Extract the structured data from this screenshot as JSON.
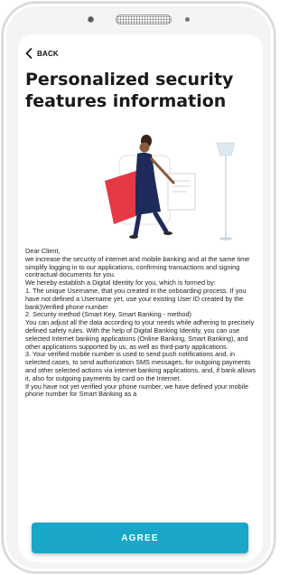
{
  "nav": {
    "back_label": "BACK"
  },
  "header": {
    "title": "Personalized security features information"
  },
  "hero": {
    "illustration": "woman-with-phone-and-document-illustration",
    "accent": "#e63946",
    "lamp_color": "#dde8f0"
  },
  "body": {
    "paragraphs": [
      "Dear Client,",
      "we increase the security of internet and mobile banking and at the same time simplify logging in to our applications, confirming transactions and signing contractual documents for you.",
      "We hereby establish a Digital Identity for you, which is formed by:",
      "1. The unique Username, that you created in the onboarding process. If you have not defined a Username yet, use your existing User ID created by the bank)Verified phone number",
      "2. Security method (Smart Key, Smart Banking - method)",
      "You can adjust all the data according to your needs while adhering to precisely defined safety rules. With the help of Digital Banking Identity, you can use selected Internet banking applications (Online Banking, Smart Banking), and other applications supported by us, as well as third-party applications.",
      "3. Your verified mobile number is used to send push notifications and, in selected cases, to send authorization SMS messages, for outgoing payments and other selected actions via internet banking applications, and, if bank allows it, also for outgoing payments by card on the Internet.",
      "If you have not yet verified your phone number, we have defined your mobile phone number for Smart Banking as a"
    ]
  },
  "footer": {
    "agree_label": "AGREE",
    "button_color": "#1aa6c9"
  }
}
